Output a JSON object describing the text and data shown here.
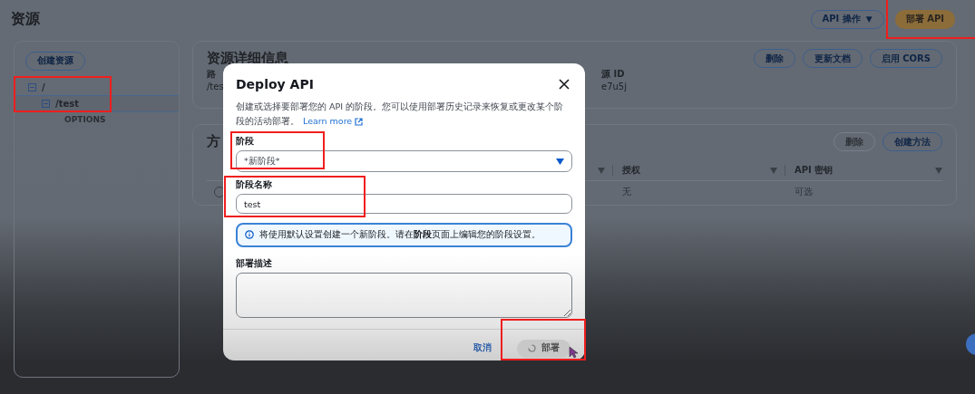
{
  "page": {
    "title": "资源",
    "actions": [
      {
        "kind": "dropdown",
        "label": "API 操作",
        "caret": "▼"
      },
      {
        "kind": "primary",
        "label": "部署 API",
        "highlighted": true
      }
    ]
  },
  "resource_tree": {
    "create_button": "创建资源",
    "highlighted": true,
    "items": [
      {
        "label": "/",
        "expanded": true,
        "selected": false,
        "children": [
          {
            "label": "/test",
            "expanded": true,
            "selected": true,
            "children": [
              {
                "label": "OPTIONS"
              }
            ]
          }
        ]
      }
    ]
  },
  "resource_details": {
    "title": "资源详细信息",
    "buttons": [
      "删除",
      "更新文档",
      "启用 CORS"
    ],
    "fields": [
      {
        "label": "路",
        "value": "/tes"
      },
      {
        "label": "源 ID",
        "value": "e7u5j"
      }
    ]
  },
  "methods": {
    "title": "方",
    "buttons": [
      {
        "label": "删除",
        "disabled": true
      },
      {
        "label": "创建方法",
        "disabled": false
      }
    ],
    "columns": [
      {
        "label": "授权"
      },
      {
        "label": "API 密钥"
      }
    ],
    "rows": [
      {
        "selected": false,
        "cells": [
          "无",
          "可选"
        ]
      }
    ]
  },
  "modal": {
    "title": "Deploy API",
    "description": "创建或选择要部署您的 API 的阶段。您可以使用部署历史记录来恢复或更改某个阶段的活动部署。",
    "link": "Learn more",
    "stage": {
      "label": "阶段",
      "value": "*新阶段*",
      "highlighted": true
    },
    "stage_name": {
      "label": "阶段名称",
      "value": "test",
      "highlighted": true
    },
    "info": "将使用默认设置创建一个新阶段。请在**阶段**页面上编辑您的阶段设置。",
    "description_field": {
      "label": "部署描述"
    },
    "cancel": "取消",
    "submit": {
      "label": "部署",
      "loading": true,
      "disabled": true,
      "highlighted": true
    }
  }
}
